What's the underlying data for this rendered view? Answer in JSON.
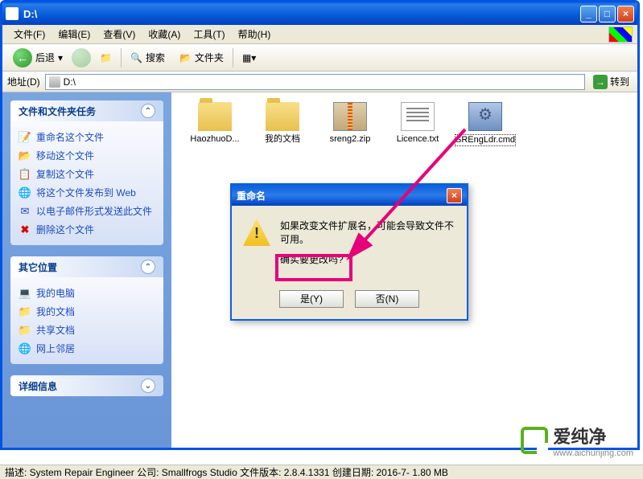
{
  "window": {
    "title": "D:\\"
  },
  "menu": {
    "file": "文件(F)",
    "edit": "编辑(E)",
    "view": "查看(V)",
    "fav": "收藏(A)",
    "tools": "工具(T)",
    "help": "帮助(H)"
  },
  "toolbar": {
    "back": "后退",
    "search": "搜索",
    "folders": "文件夹"
  },
  "address": {
    "label": "地址(D)",
    "value": "D:\\",
    "go": "转到"
  },
  "sidebar": {
    "tasks_title": "文件和文件夹任务",
    "tasks": [
      {
        "icon": "📝",
        "label": "重命名这个文件"
      },
      {
        "icon": "📂",
        "label": "移动这个文件"
      },
      {
        "icon": "📋",
        "label": "复制这个文件"
      },
      {
        "icon": "🌐",
        "label": "将这个文件发布到 Web"
      },
      {
        "icon": "✉",
        "label": "以电子邮件形式发送此文件"
      },
      {
        "icon": "✖",
        "label": "删除这个文件"
      }
    ],
    "places_title": "其它位置",
    "places": [
      {
        "icon": "💻",
        "label": "我的电脑"
      },
      {
        "icon": "📁",
        "label": "我的文档"
      },
      {
        "icon": "📁",
        "label": "共享文档"
      },
      {
        "icon": "🌐",
        "label": "网上邻居"
      }
    ],
    "details_title": "详细信息"
  },
  "files": [
    {
      "name": "HaozhuoD...",
      "type": "folder"
    },
    {
      "name": "我的文档",
      "type": "folder"
    },
    {
      "name": "sreng2.zip",
      "type": "zip"
    },
    {
      "name": "Licence.txt",
      "type": "txt"
    },
    {
      "name": "SREngLdr.cmd",
      "type": "cmd",
      "selected": true
    }
  ],
  "dialog": {
    "title": "重命名",
    "line1": "如果改变文件扩展名，可能会导致文件不可用。",
    "line2": "确实要更改吗?",
    "yes": "是(Y)",
    "no": "否(N)"
  },
  "status": "描述: System Repair Engineer 公司: Smallfrogs Studio 文件版本: 2.8.4.1331 创建日期: 2016-7-  1.80 MB",
  "watermark": {
    "brand": "爱纯净",
    "url": "www.aichunjing.com"
  }
}
